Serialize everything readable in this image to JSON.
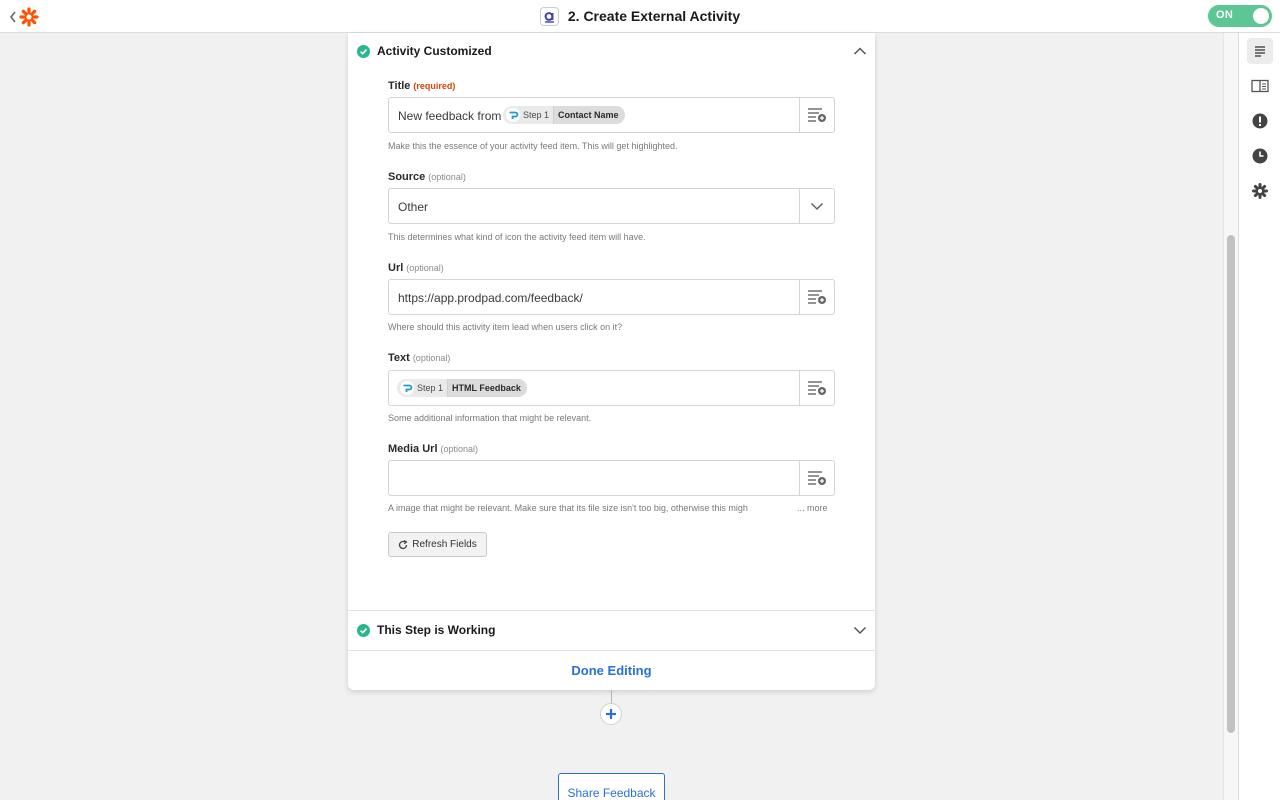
{
  "header": {
    "title": "2. Create External Activity",
    "toggle_label": "ON"
  },
  "sections": {
    "customize": {
      "title": "Activity Customized",
      "status": "complete"
    },
    "test": {
      "title": "This Step is Working",
      "status": "complete"
    }
  },
  "fields": {
    "title": {
      "label": "Title",
      "qualifier": "(required)",
      "prefix_text": "New feedback from",
      "pill_step": "Step 1",
      "pill_name": "Contact Name",
      "help": "Make this the essence of your activity feed item. This will get highlighted."
    },
    "source": {
      "label": "Source",
      "qualifier": "(optional)",
      "value": "Other",
      "help": "This determines what kind of icon the activity feed item will have."
    },
    "url": {
      "label": "Url",
      "qualifier": "(optional)",
      "value": "https://app.prodpad.com/feedback/",
      "help": "Where should this activity item lead when users click on it?"
    },
    "text": {
      "label": "Text",
      "qualifier": "(optional)",
      "pill_step": "Step 1",
      "pill_name": "HTML Feedback",
      "help": "Some additional information that might be relevant."
    },
    "media_url": {
      "label": "Media Url",
      "qualifier": "(optional)",
      "value": "",
      "help": "A image that might be relevant. Make sure that its file size isn't too big, otherwise this migh",
      "more_label": "... more"
    }
  },
  "buttons": {
    "refresh": "Refresh Fields",
    "done": "Done Editing",
    "share": "Share Feedback"
  },
  "sidebar": {
    "items": [
      "details-icon",
      "guide-icon",
      "alert-icon",
      "history-icon",
      "settings-icon"
    ]
  },
  "colors": {
    "accent_blue": "#2a6fd6",
    "success_green": "#2ab68e",
    "toggle_green": "#5dc695",
    "zapier_orange": "#ff4f00",
    "required_orange": "#d9470f"
  }
}
